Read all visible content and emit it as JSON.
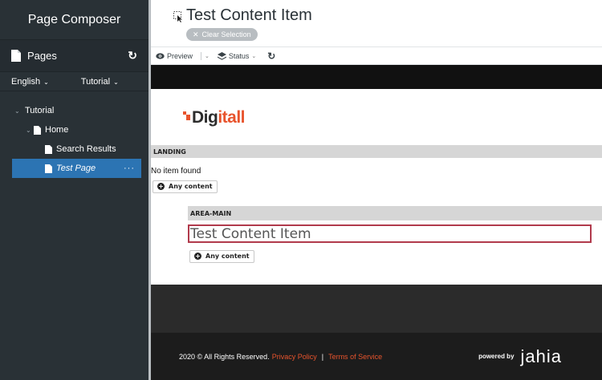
{
  "sidebar": {
    "title": "Page Composer",
    "pages_label": "Pages",
    "refresh_icon": "refresh-icon",
    "language": "English",
    "site": "Tutorial",
    "tree": [
      {
        "label": "Tutorial"
      },
      {
        "label": "Home"
      },
      {
        "label": "Search Results"
      },
      {
        "label": "Test Page",
        "more": "···"
      }
    ]
  },
  "header": {
    "title": "Test Content Item",
    "clear_selection": "Clear Selection"
  },
  "toolbar": {
    "preview": "Preview",
    "status": "Status"
  },
  "preview": {
    "logo_prefix": "Dig",
    "logo_suffix": "itall",
    "landing_label": "LANDING",
    "no_item": "No item found",
    "any_content": "Any content",
    "area_main_label": "AREA-MAIN",
    "content_item": "Test Content Item",
    "any_content_2": "Any content",
    "copyright": "2020 © All Rights Reserved.",
    "privacy": "Privacy Policy",
    "pipe": "|",
    "terms": "Terms of Service",
    "powered_by": "powered by",
    "brand": "jahia"
  },
  "colors": {
    "sidebar_bg": "#293136",
    "selected_bg": "#2c74b3",
    "accent": "#e8542d",
    "selection_border": "#b13a4c"
  }
}
